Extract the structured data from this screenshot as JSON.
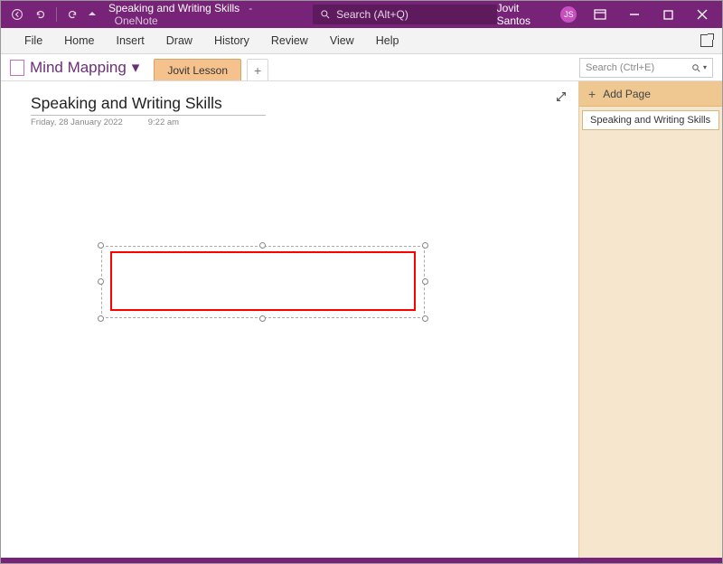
{
  "titlebar": {
    "doc_title": "Speaking and Writing Skills",
    "app_name": "OneNote",
    "search_placeholder": "Search (Alt+Q)"
  },
  "user": {
    "name": "Jovit Santos",
    "initials": "JS"
  },
  "ribbon": {
    "items": [
      "File",
      "Home",
      "Insert",
      "Draw",
      "History",
      "Review",
      "View",
      "Help"
    ]
  },
  "notebook": {
    "name": "Mind Mapping",
    "section_tab": "Jovit Lesson",
    "section_search_placeholder": "Search (Ctrl+E)"
  },
  "page": {
    "title": "Speaking and Writing Skills",
    "date": "Friday, 28 January 2022",
    "time": "9:22 am"
  },
  "right_panel": {
    "add_page_label": "Add Page",
    "pages": [
      "Speaking and Writing Skills"
    ]
  }
}
